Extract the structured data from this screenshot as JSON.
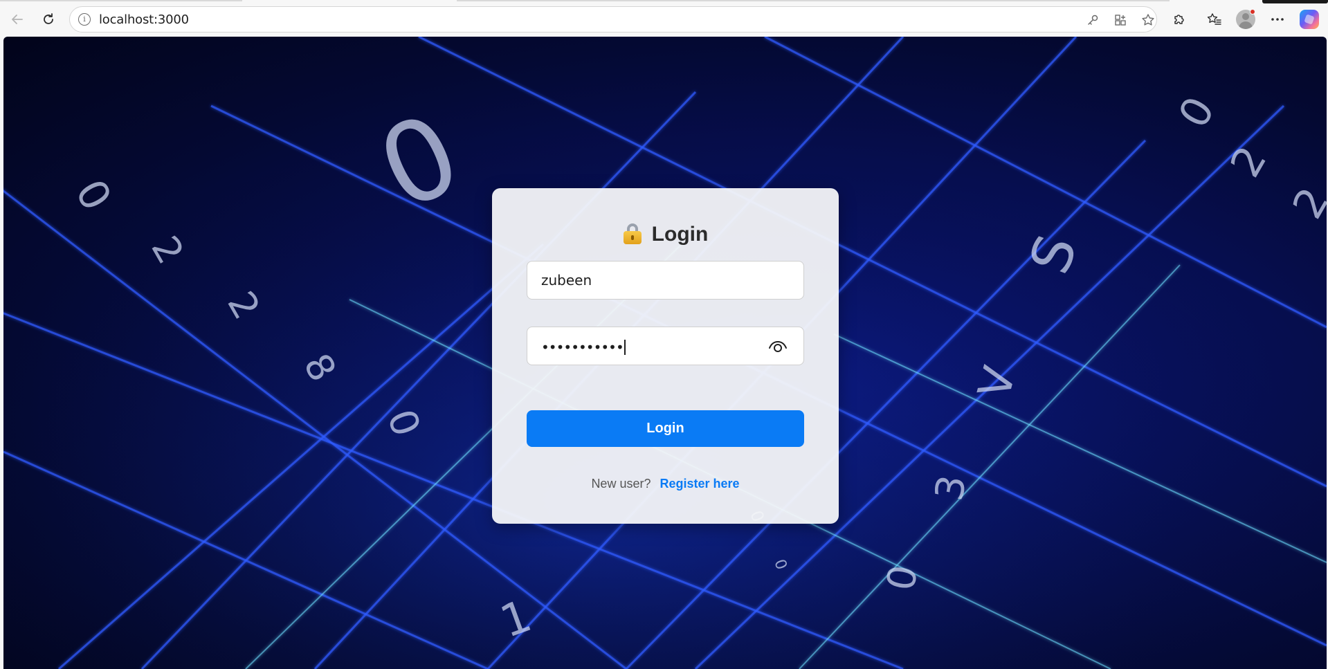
{
  "browser": {
    "url": "localhost:3000",
    "icons": {
      "back": "back-arrow-icon",
      "reload": "reload-icon",
      "site_info": "info-icon",
      "password_key": "key-icon",
      "app_available": "app-grid-icon",
      "favorite": "star-icon",
      "extensions": "puzzle-icon",
      "favorites_bar": "favorites-icon",
      "profile": "avatar-icon",
      "more": "more-icon",
      "copilot": "copilot-icon"
    }
  },
  "login": {
    "title": "Login",
    "username_value": "zubeen",
    "password_masked": "•••••••••••",
    "show_password_icon": "eye-icon",
    "submit_label": "Login",
    "register_prompt": "New user?",
    "register_link": "Register here"
  },
  "colors": {
    "primary": "#0a7bf5",
    "card_bg": "#f4f5f8",
    "page_bg": "#07105a"
  }
}
